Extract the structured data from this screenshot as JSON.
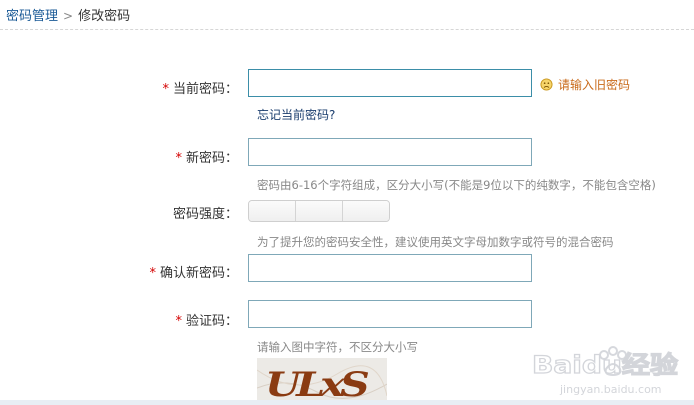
{
  "breadcrumb": {
    "parent": "密码管理",
    "separator": ">",
    "current": "修改密码"
  },
  "form": {
    "required_mark": "*",
    "current_password": {
      "label": "当前密码：",
      "value": "",
      "error": "请输入旧密码",
      "forgot_link": "忘记当前密码?"
    },
    "new_password": {
      "label": "新密码：",
      "value": "",
      "hint": "密码由6-16个字符组成，区分大小写(不能是9位以下的纯数字，不能包含空格)"
    },
    "strength": {
      "label": "密码强度：",
      "hint": "为了提升您的密码安全性，建议使用英文字母加数字或符号的混合密码"
    },
    "confirm_password": {
      "label": "确认新密码：",
      "value": ""
    },
    "captcha": {
      "label": "验证码：",
      "value": "",
      "hint": "请输入图中字符，不区分大小写",
      "image_text": "ULxS"
    }
  },
  "watermark": {
    "brand": "Baidu经验",
    "url": "jingyan.baidu.com"
  },
  "colors": {
    "link": "#1a5a96",
    "required": "#d40000",
    "error": "#c96a1a",
    "input_border": "#7fa8b8"
  }
}
